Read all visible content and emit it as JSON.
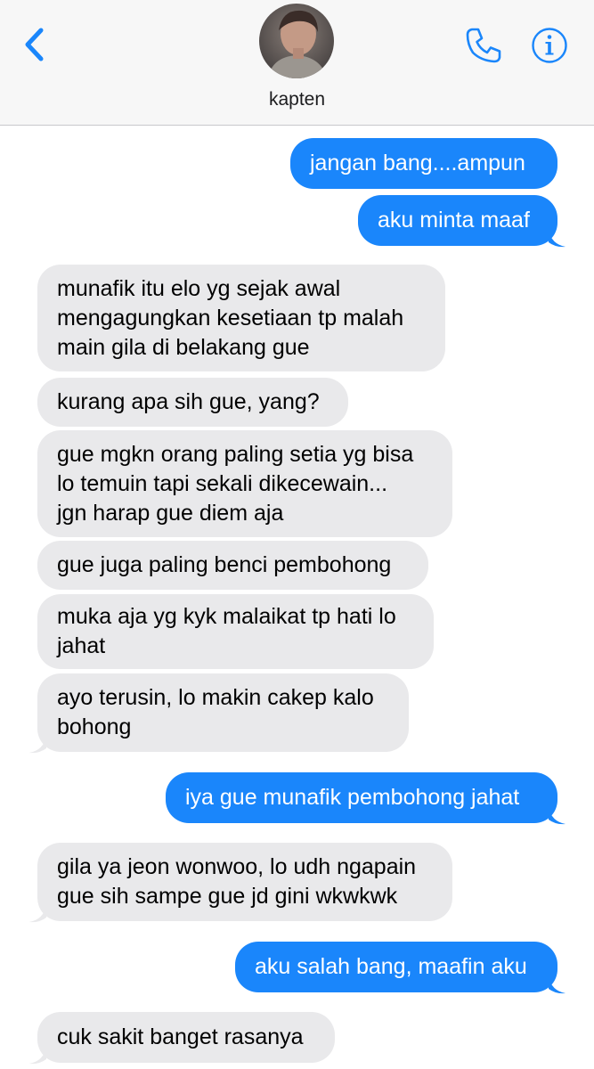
{
  "header": {
    "contact_name": "kapten",
    "back_icon": "chevron-left-icon",
    "call_icon": "phone-icon",
    "info_icon": "info-icon",
    "accent_color": "#1a86fb"
  },
  "messages": [
    {
      "direction": "outgoing",
      "text": "jangan bang....ampun"
    },
    {
      "direction": "outgoing",
      "text": "aku minta maaf"
    },
    {
      "direction": "incoming",
      "text": "munafik itu elo yg sejak awal\nmengagungkan kesetiaan tp malah\nmain gila di belakang gue"
    },
    {
      "direction": "incoming",
      "text": "kurang apa sih gue, yang?"
    },
    {
      "direction": "incoming",
      "text": "gue mgkn orang paling setia yg bisa\nlo temuin tapi sekali dikecewain...\njgn harap gue diem aja"
    },
    {
      "direction": "incoming",
      "text": "gue juga paling benci pembohong"
    },
    {
      "direction": "incoming",
      "text": "muka aja yg kyk malaikat tp hati lo\njahat"
    },
    {
      "direction": "incoming",
      "text": "ayo terusin, lo makin cakep kalo\nbohong"
    },
    {
      "direction": "outgoing",
      "text": "iya gue munafik pembohong jahat"
    },
    {
      "direction": "incoming",
      "text": "gila ya jeon wonwoo, lo udh ngapain\ngue sih sampe gue jd gini wkwkwk"
    },
    {
      "direction": "outgoing",
      "text": "aku salah bang, maafin aku"
    },
    {
      "direction": "incoming",
      "text": "cuk sakit banget rasanya"
    }
  ]
}
